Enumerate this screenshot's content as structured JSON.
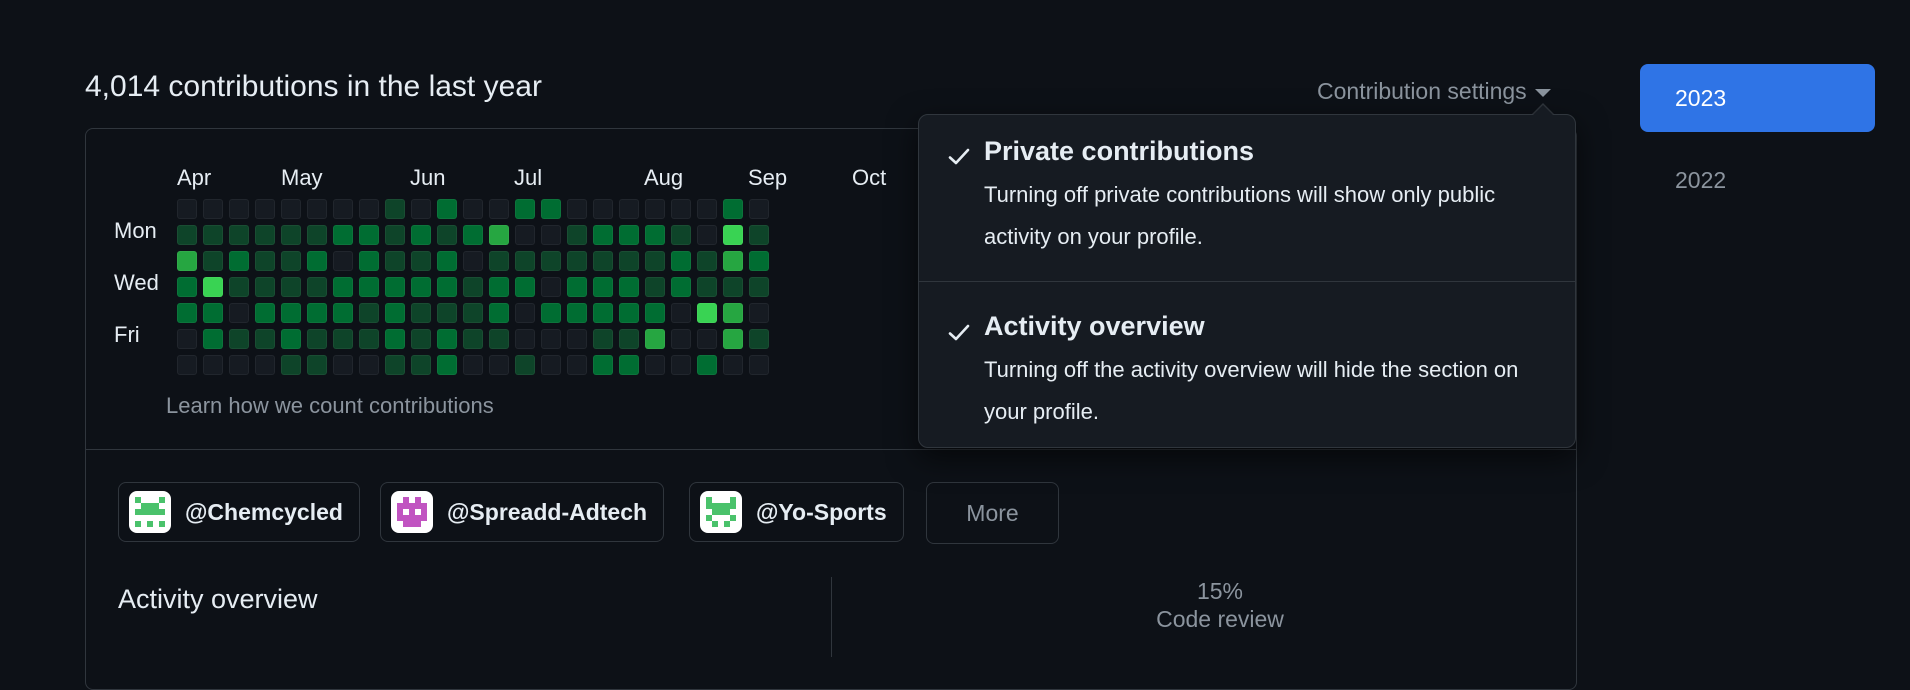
{
  "header": {
    "contributions_title": "4,014 contributions in the last year"
  },
  "settings": {
    "toggle_label": "Contribution settings"
  },
  "calendar": {
    "months": [
      "Apr",
      "May",
      "Jun",
      "Jul",
      "Aug",
      "Sep",
      "Oct"
    ],
    "days": [
      "Mon",
      "Wed",
      "Fri"
    ],
    "learn_link": "Learn how we count contributions",
    "colors": [
      "#161b22",
      "#0e4429",
      "#006d32",
      "#26a641",
      "#39d353"
    ]
  },
  "orgs": [
    {
      "name": "@Chemcycled",
      "avatar_color": "#4ac26b"
    },
    {
      "name": "@Spreadd-Adtech",
      "avatar_color": "#c154c1"
    },
    {
      "name": "@Yo-Sports",
      "avatar_color": "#4ac26b"
    }
  ],
  "more_label": "More",
  "activity": {
    "title": "Activity overview",
    "code_review_pct": "15%",
    "code_review_label": "Code review"
  },
  "years": [
    "2023",
    "2022"
  ],
  "dropdown": {
    "items": [
      {
        "title": "Private contributions",
        "description": "Turning off private contributions will show only public activity on your profile.",
        "checked": true
      },
      {
        "title": "Activity overview",
        "description": "Turning off the activity overview will hide the section on your profile.",
        "checked": true
      }
    ]
  }
}
